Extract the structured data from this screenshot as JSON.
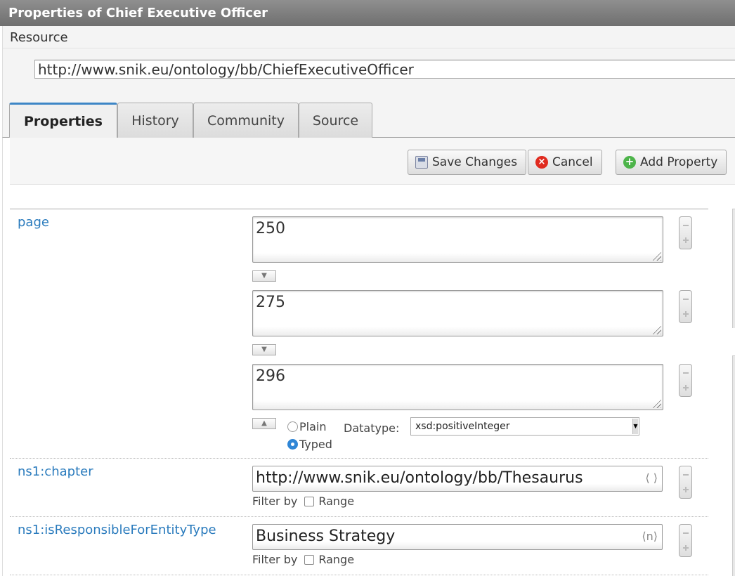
{
  "window": {
    "title": "Properties of Chief Executive Officer"
  },
  "resource": {
    "label": "Resource",
    "uri": "http://www.snik.eu/ontology/bb/ChiefExecutiveOfficer"
  },
  "tabs": [
    {
      "label": "Properties",
      "active": true
    },
    {
      "label": "History",
      "active": false
    },
    {
      "label": "Community",
      "active": false
    },
    {
      "label": "Source",
      "active": false
    }
  ],
  "toolbar": {
    "save_label": "Save Changes",
    "cancel_label": "Cancel",
    "add_label": "Add Property"
  },
  "properties": {
    "page": {
      "name": "page",
      "values": [
        "250",
        "275",
        "296"
      ],
      "type_options": {
        "plain_label": "Plain",
        "typed_label": "Typed",
        "selected": "Typed"
      },
      "datatype_label": "Datatype:",
      "datatype_value": "xsd:positiveInteger"
    },
    "chapter": {
      "name": "ns1:chapter",
      "value": "http://www.snik.eu/ontology/bb/Thesaurus",
      "value_icon": "⟨ ⟩",
      "filter_label": "Filter by",
      "range_label": "Range"
    },
    "responsible": {
      "name": "ns1:isResponsibleForEntityType",
      "value": "Business Strategy",
      "value_icon": "⟨n⟩",
      "filter_label": "Filter by",
      "range_label": "Range"
    }
  },
  "icons": {
    "save": "save-icon",
    "cancel": "cancel-icon",
    "add": "add-icon",
    "move_down": "arrow-down-icon",
    "move_up": "arrow-up-icon",
    "resize": "resize-grip-icon"
  },
  "colors": {
    "accent": "#3d86c6",
    "link": "#2a7bbd",
    "cancel": "#e02b1f",
    "add": "#4db44a"
  }
}
